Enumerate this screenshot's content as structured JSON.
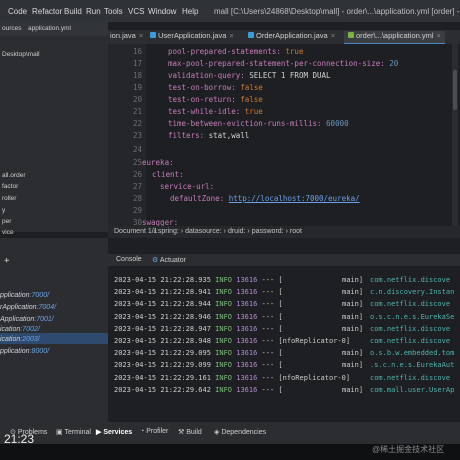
{
  "menubar": {
    "items": [
      "Code",
      "Refactor",
      "Build",
      "Run",
      "Tools",
      "VCS",
      "Window",
      "Help"
    ],
    "title": "mall [C:\\Users\\24868\\Desktop\\mall] - order\\...\\application.yml [order] - Ex"
  },
  "project": {
    "lines": [
      "ources",
      "application.yml",
      "Desktop\\mall",
      "all.order",
      "factor",
      "roller",
      "y",
      "per",
      "vice"
    ]
  },
  "tabs": [
    "ion.java",
    "UserApplication.java",
    "OrderApplication.java",
    "order\\...\\application.yml"
  ],
  "editor": {
    "lines": [
      {
        "n": "16",
        "key": "pool-prepared-statements:",
        "val": "true"
      },
      {
        "n": "17",
        "key": "max-pool-prepared-statement-per-connection-size:",
        "val": "20"
      },
      {
        "n": "18",
        "key": "validation-query:",
        "val": "SELECT 1 FROM DUAL"
      },
      {
        "n": "19",
        "key": "test-on-borrow:",
        "val": "false"
      },
      {
        "n": "20",
        "key": "test-on-return:",
        "val": "false"
      },
      {
        "n": "21",
        "key": "test-while-idle:",
        "val": "true"
      },
      {
        "n": "22",
        "key": "time-between-eviction-runs-millis:",
        "val": "60000"
      },
      {
        "n": "23",
        "key": "filters:",
        "val": "stat,wall"
      },
      {
        "n": "24",
        "key": "",
        "val": ""
      },
      {
        "n": "25",
        "key": "eureka:",
        "val": ""
      },
      {
        "n": "26",
        "key": "client:",
        "val": ""
      },
      {
        "n": "27",
        "key": "service-url:",
        "val": ""
      },
      {
        "n": "28",
        "key": "defaultZone:",
        "val": "http://localhost:7000/eureka/"
      },
      {
        "n": "29",
        "key": "",
        "val": ""
      },
      {
        "n": "30",
        "key": "swagger:",
        "val": ""
      }
    ]
  },
  "breadcrumb": [
    "Document 1/1",
    "spring:",
    "datasource:",
    "druid:",
    "password:",
    "root"
  ],
  "services": {
    "items": [
      {
        "name": "pplication",
        "port": ":7000/"
      },
      {
        "name": "rApplication",
        "port": ":7004/"
      },
      {
        "name": "Application",
        "port": ":7001/"
      },
      {
        "name": "ication",
        "port": ":7002/"
      },
      {
        "name": "ication",
        "port": ":2003/"
      },
      {
        "name": "pplication",
        "port": ":8000/"
      }
    ]
  },
  "console": {
    "tabs": [
      "Console",
      "Actuator"
    ],
    "logs": [
      {
        "ts": "2023-04-15 21:22:28.935",
        "lvl": "INFO",
        "pid": "13616",
        "sep": "---",
        "thread": "[",
        "th2": "main]",
        "cls": "com.netflix.discove"
      },
      {
        "ts": "2023-04-15 21:22:28.941",
        "lvl": "INFO",
        "pid": "13616",
        "sep": "---",
        "thread": "[",
        "th2": "main]",
        "cls": "c.n.discovery.Instan"
      },
      {
        "ts": "2023-04-15 21:22:28.944",
        "lvl": "INFO",
        "pid": "13616",
        "sep": "---",
        "thread": "[",
        "th2": "main]",
        "cls": "com.netflix.discove"
      },
      {
        "ts": "2023-04-15 21:22:28.946",
        "lvl": "INFO",
        "pid": "13616",
        "sep": "---",
        "thread": "[",
        "th2": "main]",
        "cls": "o.s.c.n.e.s.EurekaSe"
      },
      {
        "ts": "2023-04-15 21:22:28.947",
        "lvl": "INFO",
        "pid": "13616",
        "sep": "---",
        "thread": "[",
        "th2": "main]",
        "cls": "com.netflix.discove"
      },
      {
        "ts": "2023-04-15 21:22:28.948",
        "lvl": "INFO",
        "pid": "13616",
        "sep": "---",
        "thread": "[nfoReplicator-0]",
        "th2": "",
        "cls": "com.netflix.discove"
      },
      {
        "ts": "2023-04-15 21:22:29.095",
        "lvl": "INFO",
        "pid": "13616",
        "sep": "---",
        "thread": "[",
        "th2": "main]",
        "cls": "o.s.b.w.embedded.tom"
      },
      {
        "ts": "2023-04-15 21:22:29.099",
        "lvl": "INFO",
        "pid": "13616",
        "sep": "---",
        "thread": "[",
        "th2": "main]",
        "cls": ".s.c.n.e.s.EurekaAut"
      },
      {
        "ts": "2023-04-15 21:22:29.161",
        "lvl": "INFO",
        "pid": "13616",
        "sep": "---",
        "thread": "[nfoReplicator-0]",
        "th2": "",
        "cls": "com.netflix.discove"
      },
      {
        "ts": "2023-04-15 21:22:29.642",
        "lvl": "INFO",
        "pid": "13616",
        "sep": "---",
        "thread": "[",
        "th2": "main]",
        "cls": "com.mall.user.UserAp"
      }
    ]
  },
  "bottombar": {
    "items": [
      "Problems",
      "Terminal",
      "Services",
      "Profiler",
      "Build",
      "Dependencies"
    ]
  },
  "clock": "21:23",
  "watermark": "@稀土掘金技术社区",
  "colors": {
    "accent": "#4a88c7",
    "selection": "#2e4a6e"
  }
}
